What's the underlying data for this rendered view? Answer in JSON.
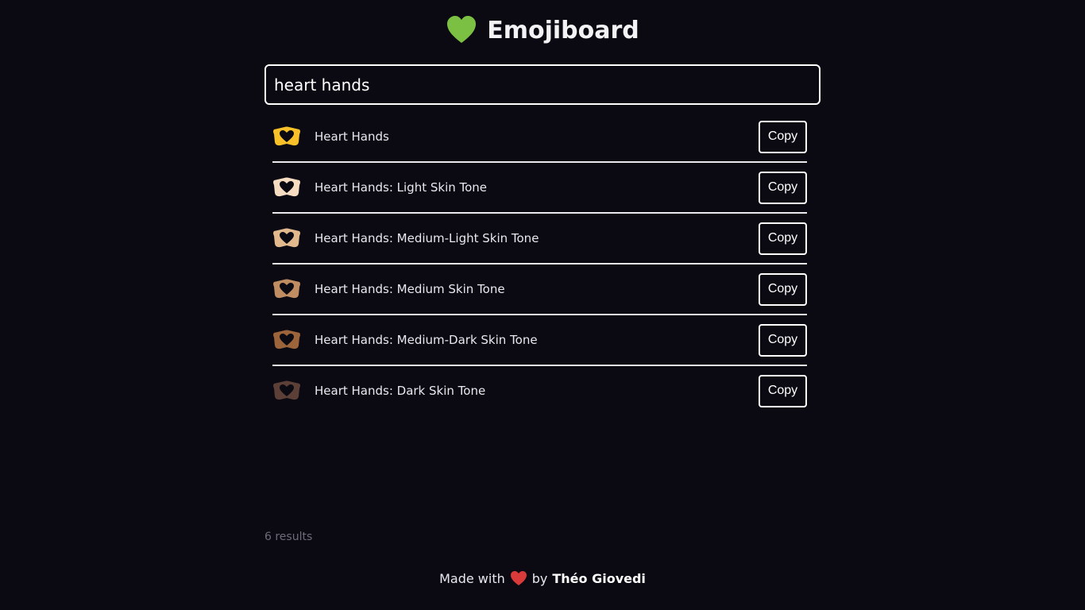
{
  "header": {
    "title": "Emojiboard",
    "icon": "green-heart-icon",
    "icon_color": "#7bc043"
  },
  "search": {
    "value": "heart hands",
    "placeholder": ""
  },
  "results": [
    {
      "name": "Heart Hands",
      "skin_color": "#f8c12a",
      "copy_label": "Copy"
    },
    {
      "name": "Heart Hands: Light Skin Tone",
      "skin_color": "#f6dcc0",
      "copy_label": "Copy"
    },
    {
      "name": "Heart Hands: Medium-Light Skin Tone",
      "skin_color": "#e1b98d",
      "copy_label": "Copy"
    },
    {
      "name": "Heart Hands: Medium Skin Tone",
      "skin_color": "#c08d62",
      "copy_label": "Copy"
    },
    {
      "name": "Heart Hands: Medium-Dark Skin Tone",
      "skin_color": "#9b643a",
      "copy_label": "Copy"
    },
    {
      "name": "Heart Hands: Dark Skin Tone",
      "skin_color": "#5c4037",
      "copy_label": "Copy"
    }
  ],
  "result_count": "6 results",
  "footer": {
    "prefix": "Made with",
    "heart_icon": "red-heart-icon",
    "heart_color": "#d93a3a",
    "by": "by",
    "author": "Théo Giovedi"
  }
}
